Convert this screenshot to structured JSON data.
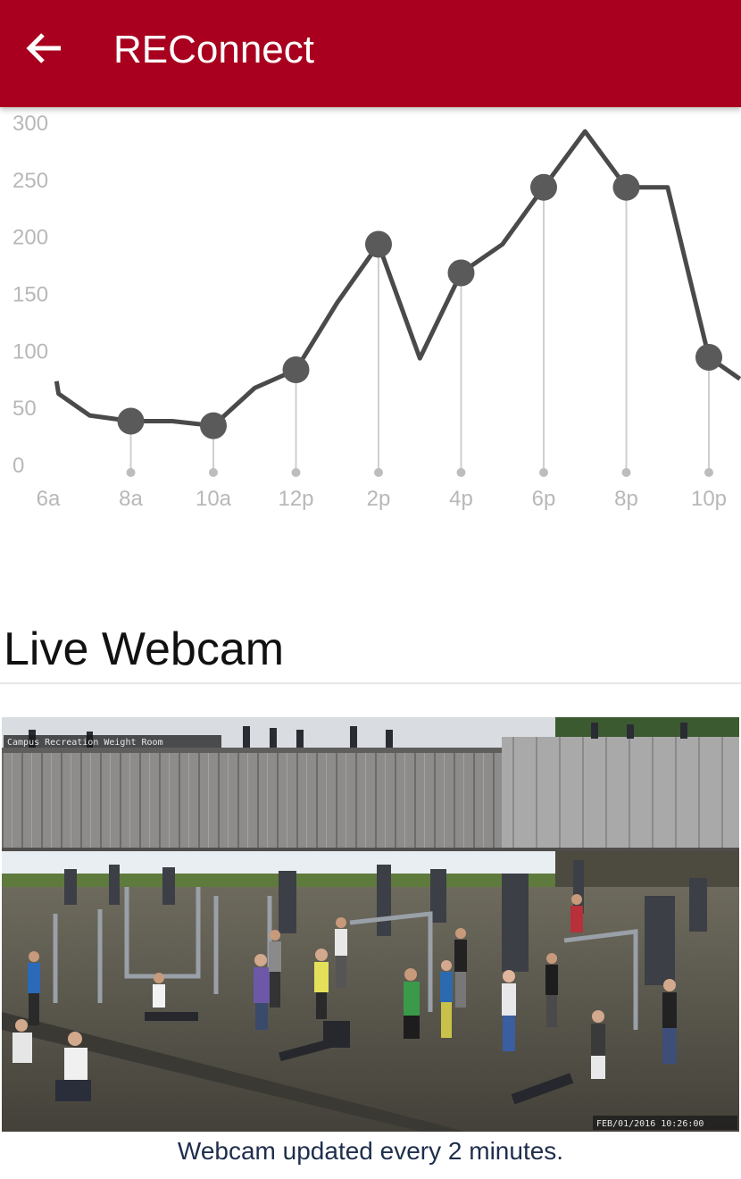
{
  "app_bar": {
    "title": "REConnect",
    "back_icon": "arrow-left-icon",
    "color": "#a8001e"
  },
  "chart_data": {
    "type": "line",
    "title": "",
    "xlabel": "",
    "ylabel": "",
    "x_ticks": [
      "6a",
      "8a",
      "10a",
      "12p",
      "2p",
      "4p",
      "6p",
      "8p",
      "10p"
    ],
    "y_ticks": [
      0,
      50,
      100,
      150,
      200,
      250,
      300
    ],
    "ylim": [
      0,
      300
    ],
    "grid": false,
    "line_color": "#4a4a4a",
    "series": [
      {
        "points": [
          {
            "x": 6.2,
            "y": 73
          },
          {
            "x": 6.25,
            "y": 62
          },
          {
            "x": 7.0,
            "y": 43
          },
          {
            "x": 8.0,
            "y": 38
          },
          {
            "x": 9.0,
            "y": 38
          },
          {
            "x": 10.0,
            "y": 34
          },
          {
            "x": 11.0,
            "y": 67
          },
          {
            "x": 12.0,
            "y": 83
          },
          {
            "x": 13.0,
            "y": 142
          },
          {
            "x": 14.0,
            "y": 193
          },
          {
            "x": 15.0,
            "y": 93
          },
          {
            "x": 16.0,
            "y": 168
          },
          {
            "x": 17.0,
            "y": 193
          },
          {
            "x": 18.0,
            "y": 243
          },
          {
            "x": 19.0,
            "y": 292
          },
          {
            "x": 20.0,
            "y": 243
          },
          {
            "x": 21.0,
            "y": 243
          },
          {
            "x": 22.0,
            "y": 94
          },
          {
            "x": 22.75,
            "y": 75
          }
        ],
        "markers": [
          {
            "x": 8,
            "y": 38
          },
          {
            "x": 10,
            "y": 34
          },
          {
            "x": 12,
            "y": 83
          },
          {
            "x": 14,
            "y": 193
          },
          {
            "x": 16,
            "y": 168
          },
          {
            "x": 18,
            "y": 243
          },
          {
            "x": 20,
            "y": 243
          },
          {
            "x": 22,
            "y": 94
          }
        ]
      }
    ]
  },
  "webcam": {
    "section_title": "Live Webcam",
    "overlay_label": "Campus Recreation Weight Room",
    "timestamp": "FEB/01/2016 10:26:00",
    "caption": "Webcam updated every 2 minutes."
  }
}
